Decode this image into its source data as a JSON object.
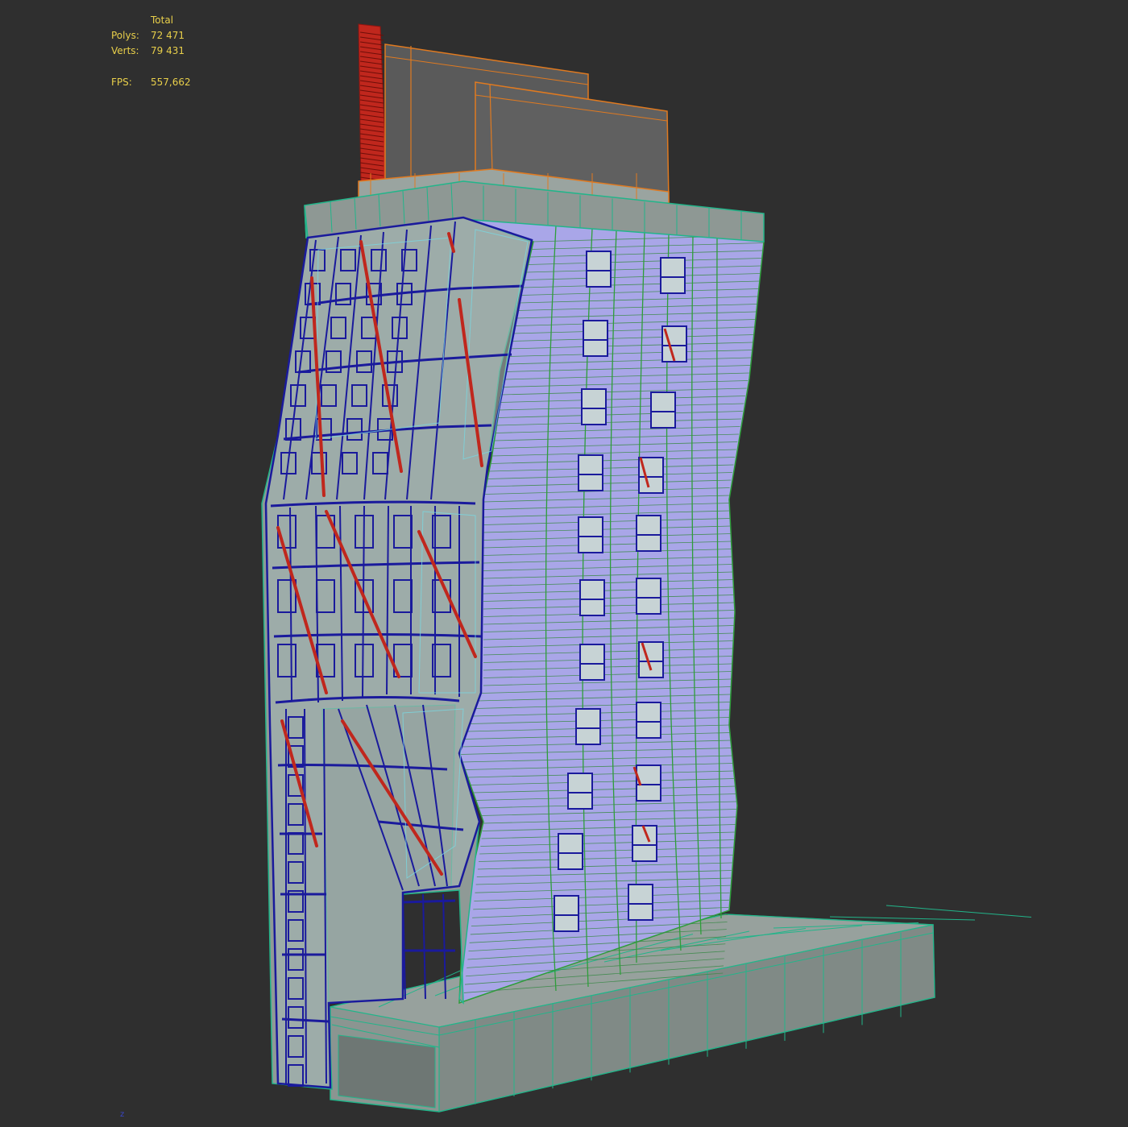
{
  "viewport": {
    "stats": {
      "header": "Total",
      "polys_label": "Polys:",
      "polys_value": "72 471",
      "verts_label": "Verts:",
      "verts_value": "79 431",
      "fps_label": "FPS:",
      "fps_value": "557,662"
    },
    "axis_label": "z"
  },
  "colors": {
    "background": "#2f2f2f",
    "stats_text": "#e8cf4a",
    "wire_teal": "#22b58a",
    "wire_green": "#2e9e3a",
    "wire_blue": "#1a1a9c",
    "wire_orange": "#e07a20",
    "facade_lavender": "#a9a6e8",
    "shell_gray": "#8a9490",
    "diagonal_red": "#c0271d"
  }
}
